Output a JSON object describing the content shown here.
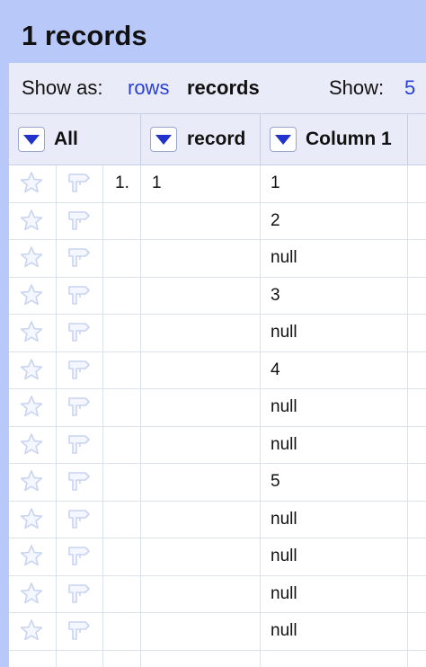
{
  "header": {
    "title": "1 records"
  },
  "view_bar": {
    "show_as_label": "Show as:",
    "rows_link": "rows",
    "records_label": "records",
    "show_label": "Show:",
    "show_value": "5"
  },
  "columns": [
    {
      "label": "All"
    },
    {
      "label": "record"
    },
    {
      "label": "Column 1"
    }
  ],
  "rows": [
    {
      "index": "1.",
      "record": "1",
      "column1": "1"
    },
    {
      "index": "",
      "record": "",
      "column1": "2"
    },
    {
      "index": "",
      "record": "",
      "column1": "null"
    },
    {
      "index": "",
      "record": "",
      "column1": "3"
    },
    {
      "index": "",
      "record": "",
      "column1": "null"
    },
    {
      "index": "",
      "record": "",
      "column1": "4"
    },
    {
      "index": "",
      "record": "",
      "column1": "null"
    },
    {
      "index": "",
      "record": "",
      "column1": "null"
    },
    {
      "index": "",
      "record": "",
      "column1": "5"
    },
    {
      "index": "",
      "record": "",
      "column1": "null"
    },
    {
      "index": "",
      "record": "",
      "column1": "null"
    },
    {
      "index": "",
      "record": "",
      "column1": "null"
    },
    {
      "index": "",
      "record": "",
      "column1": "null"
    }
  ],
  "icons": {
    "star": "star-icon",
    "flag": "flag-icon",
    "dropdown": "chevron-down-icon"
  },
  "colors": {
    "frame": "#b8c8f8",
    "toolbar": "#e9ecf8",
    "link": "#2a3fd3",
    "dropdown_arrow": "#2233cc"
  }
}
